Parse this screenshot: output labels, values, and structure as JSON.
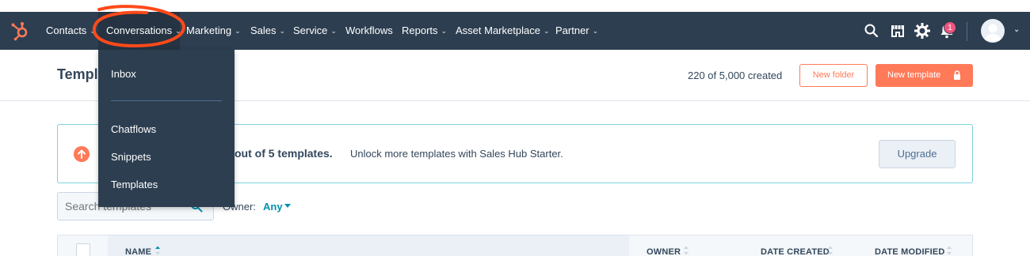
{
  "navbar": {
    "items": [
      {
        "label": "Contacts"
      },
      {
        "label": "Conversations"
      },
      {
        "label": "Marketing"
      },
      {
        "label": "Sales"
      },
      {
        "label": "Service"
      },
      {
        "label": "Workflows"
      },
      {
        "label": "Reports"
      },
      {
        "label": "Asset Marketplace"
      },
      {
        "label": "Partner"
      }
    ],
    "notification_count": "1",
    "chevron": "⌄"
  },
  "conversations_menu": {
    "items": [
      {
        "label": "Inbox"
      },
      {
        "label": "Chatflows"
      },
      {
        "label": "Snippets"
      },
      {
        "label": "Templates"
      }
    ]
  },
  "header": {
    "title": "Templ",
    "count_text": "220 of 5,000 created",
    "new_folder_label": "New folder",
    "new_template_label": "New template"
  },
  "banner": {
    "bold_text": "out of 5 templates.",
    "text": "Unlock more templates with Sales Hub Starter.",
    "upgrade_label": "Upgrade"
  },
  "filters": {
    "search_placeholder": "Search templates",
    "owner_label": "Owner:",
    "owner_value": "Any"
  },
  "table": {
    "columns": [
      {
        "label": "NAME"
      },
      {
        "label": "OWNER"
      },
      {
        "label": "DATE CREATED"
      },
      {
        "label": "DATE MODIFIED"
      }
    ]
  },
  "colors": {
    "nav_bg": "#2d3e50",
    "accent": "#ff7a59",
    "link": "#0091ae",
    "annotation": "#ff4a1a"
  }
}
